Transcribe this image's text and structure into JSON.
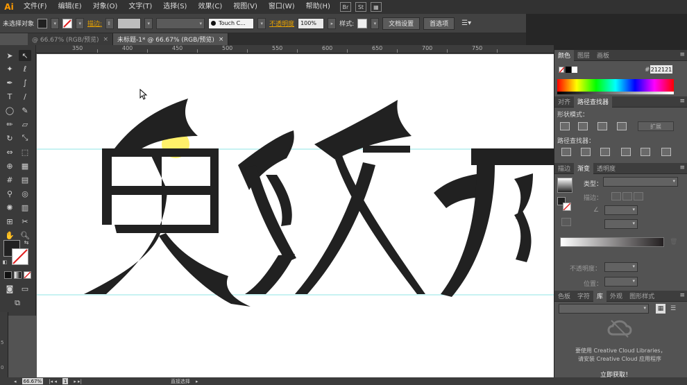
{
  "app": {
    "logo": "Ai"
  },
  "menu": [
    "文件(F)",
    "编辑(E)",
    "对象(O)",
    "文字(T)",
    "选择(S)",
    "效果(C)",
    "视图(V)",
    "窗口(W)",
    "帮助(H)"
  ],
  "menubar_icons": {
    "bridge": "Br",
    "stock": "St"
  },
  "controlbar": {
    "selection_status": "未选择对象",
    "stroke_label": "描边:",
    "brush_name": "Touch C...",
    "opacity_label": "不透明度",
    "opacity_value": "100%",
    "style_label": "样式:",
    "doc_setup_button": "文档设置",
    "preferences_button": "首选项"
  },
  "tabs": [
    {
      "label": "@ 66.67% (RGB/预览)",
      "close": "×"
    },
    {
      "label": "未标题-1* @ 66.67% (RGB/预览)",
      "close": "×"
    }
  ],
  "ruler": {
    "labels": [
      "350",
      "400",
      "450",
      "500",
      "550",
      "600",
      "650",
      "700",
      "750"
    ]
  },
  "vruler_labels": [
    "5",
    "0"
  ],
  "artwork": {
    "fill": "#212121",
    "guide_color": "#8fe6e6",
    "highlight_color": "#fff06a"
  },
  "panels": {
    "color": {
      "tabs": [
        "颜色",
        "图层",
        "画板"
      ],
      "hex_prefix": "#",
      "hex_value": "212121"
    },
    "pathfinder": {
      "tabs": [
        "对齐",
        "路径查找器"
      ],
      "shape_modes_label": "形状模式：",
      "expand_button": "扩展",
      "pathfinders_label": "路径查找器："
    },
    "gradient": {
      "tabs": [
        "描边",
        "渐变",
        "透明度"
      ],
      "type_label": "类型：",
      "stroke_label": "描边：",
      "opacity_label": "不透明度：",
      "position_label": "位置："
    },
    "library": {
      "tabs": [
        "色板",
        "字符",
        "库",
        "外观",
        "图形样式"
      ],
      "message_line1": "要使用 Creative Cloud Libraries，",
      "message_line2": "请安装 Creative Cloud 应用程序",
      "install_button": "立即获取！"
    }
  },
  "statusbar": {
    "zoom": "66.67%",
    "page": "1",
    "tool_status": "直接选择"
  }
}
